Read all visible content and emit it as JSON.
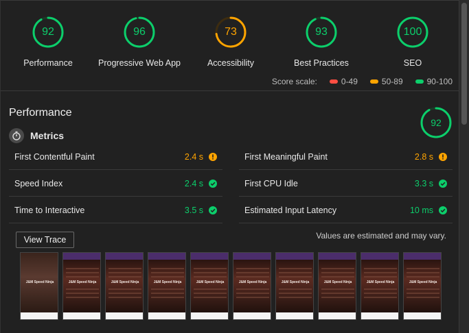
{
  "scores": [
    {
      "value": "92",
      "label": "Performance",
      "score": 92,
      "color": "#0cce6b"
    },
    {
      "value": "96",
      "label": "Progressive Web App",
      "score": 96,
      "color": "#0cce6b"
    },
    {
      "value": "73",
      "label": "Accessibility",
      "score": 73,
      "color": "#ffa400"
    },
    {
      "value": "93",
      "label": "Best Practices",
      "score": 93,
      "color": "#0cce6b"
    },
    {
      "value": "100",
      "label": "SEO",
      "score": 100,
      "color": "#0cce6b"
    }
  ],
  "scale": {
    "title": "Score scale:",
    "ranges": [
      {
        "label": "0-49",
        "color": "#ff4e42"
      },
      {
        "label": "50-89",
        "color": "#ffa400"
      },
      {
        "label": "90-100",
        "color": "#0cce6b"
      }
    ]
  },
  "performance": {
    "title": "Performance",
    "score": "92",
    "score_value": 92,
    "metrics_title": "Metrics",
    "metrics": [
      {
        "name": "First Contentful Paint",
        "value": "2.4 s",
        "status": "average",
        "icon": "info-icon"
      },
      {
        "name": "First Meaningful Paint",
        "value": "2.8 s",
        "status": "average",
        "icon": "info-icon"
      },
      {
        "name": "Speed Index",
        "value": "2.4 s",
        "status": "pass",
        "icon": "check-icon"
      },
      {
        "name": "First CPU Idle",
        "value": "3.3 s",
        "status": "pass",
        "icon": "check-icon"
      },
      {
        "name": "Time to Interactive",
        "value": "3.5 s",
        "status": "pass",
        "icon": "check-icon"
      },
      {
        "name": "Estimated Input Latency",
        "value": "10 ms",
        "status": "pass",
        "icon": "check-icon"
      }
    ],
    "view_trace": "View Trace",
    "estimate_note": "Values are estimated and may vary.",
    "filmstrip_title": "J&M Speed Ninja"
  },
  "colors": {
    "pass": "#0cce6b",
    "average": "#ffa400",
    "fail": "#ff4e42"
  }
}
